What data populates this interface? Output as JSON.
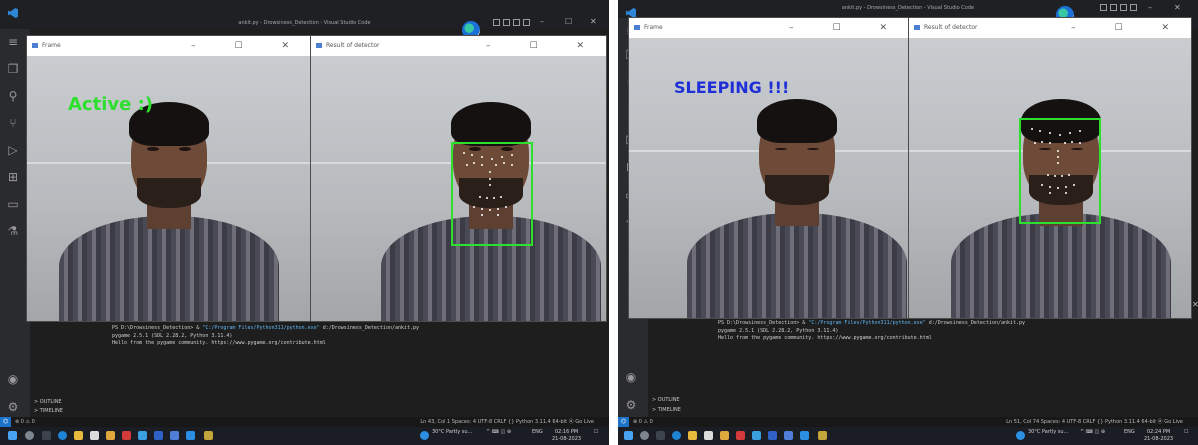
{
  "left": {
    "window_title": "ankit.py - Drowsiness_Detection - Visual Studio Code",
    "frame_title": "Frame",
    "detector_title": "Result of detector",
    "status_text": "Active :)",
    "terminal": [
      "PS D:\\Drowsiness_Detection> & ",
      "\"C:/Program Files/Python311/python.exe\"",
      " d:/Drowsiness_Detection/ankit.py",
      "pygame 2.5.1 (SDL 2.28.2, Python 3.11.4)",
      "Hello from the pygame community. https://www.pygame.org/contribute.html"
    ],
    "outline": "> OUTLINE",
    "timeline": "> TIMELINE",
    "status_left": "⊗ 0 ⚠ 0",
    "status_right": "Ln 43, Col 1   Spaces: 4   UTF-8   CRLF   {} Python   3.11.4 64-bit   ⦿ Go Live",
    "weather": "30°C  Partly su...",
    "lang": "ENG",
    "time": "02:16 PM",
    "date": "21-08-2023"
  },
  "right": {
    "window_title": "ankit.py - Drowsiness_Detection - Visual Studio Code",
    "frame_title": "Frame",
    "detector_title": "Result of detector",
    "status_text": "SLEEPING !!!",
    "terminal": [
      "PS D:\\Drowsiness_Detection> & ",
      "\"C:/Program Files/Python311/python.exe\"",
      " d:/Drowsiness_Detection/ankit.py",
      "pygame 2.5.1 (SDL 2.28.2, Python 3.11.4)",
      "Hello from the pygame community. https://www.pygame.org/contribute.html"
    ],
    "outline": "> OUTLINE",
    "timeline": "> TIMELINE",
    "status_left": "⊗ 0 ⚠ 0",
    "status_right": "Ln 51, Col 74   Spaces: 4   UTF-8   CRLF   {} Python   3.11.4 64-bit   ⦿ Go Live",
    "weather": "30°C  Partly su...",
    "lang": "ENG",
    "time": "02:24 PM",
    "date": "21-08-2023"
  },
  "colors": {
    "active_text": "#2de02d",
    "sleeping_text": "#1f2fd8",
    "face_box": "#2ee02e",
    "vscode_accent": "#1d73c9"
  },
  "icons": [
    "vscode-logo-icon",
    "edge-browser-icon",
    "explorer-icon",
    "search-icon",
    "source-control-icon",
    "run-debug-icon",
    "extensions-icon",
    "remote-explorer-icon",
    "testing-icon",
    "account-icon",
    "settings-gear-icon",
    "windows-start-icon"
  ]
}
